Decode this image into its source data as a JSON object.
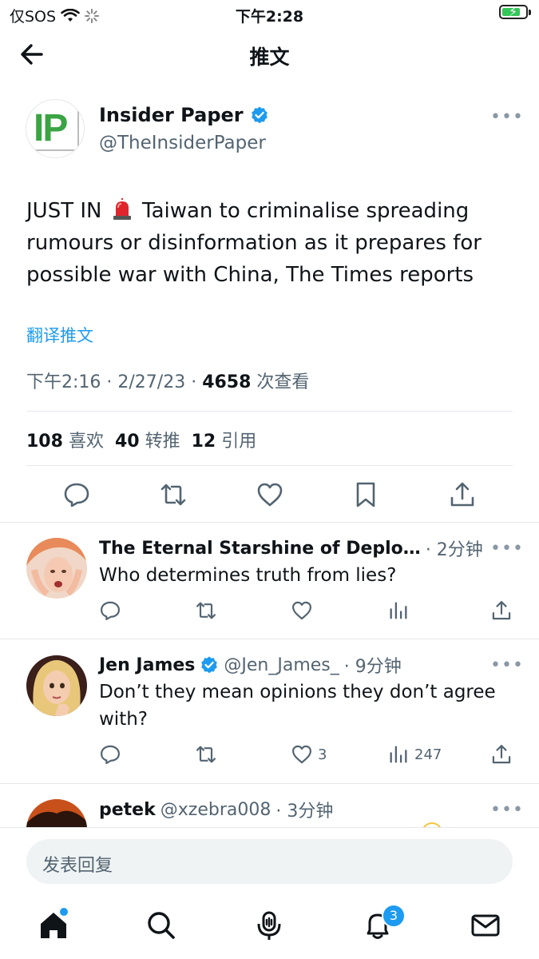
{
  "status_bar": {
    "carrier": "仅SOS",
    "time": "下午2:28"
  },
  "header": {
    "title": "推文"
  },
  "main_tweet": {
    "author_name": "Insider Paper",
    "author_handle": "@TheInsiderPaper",
    "avatar_text": "IP",
    "text_prefix": "JUST IN",
    "text_body": " Taiwan to criminalise spreading rumours or disinformation as it prepares for possible war with China, The Times reports",
    "translate_label": "翻译推文",
    "time": "下午2:16",
    "date": "2/27/23",
    "views_count": "4658",
    "views_label": "次查看",
    "likes_count": "108",
    "likes_label": "喜欢",
    "retweets_count": "40",
    "retweets_label": "转推",
    "quotes_count": "12",
    "quotes_label": "引用"
  },
  "replies": [
    {
      "name": "The Eternal Starshine of Deplo…",
      "time": "· 2分钟",
      "text": "Who determines truth from lies?",
      "likes": "",
      "views": ""
    },
    {
      "name": "Jen James",
      "handle": "@Jen_James_",
      "time": "· 9分钟",
      "text": "Don’t they mean opinions they don’t agree with?",
      "likes": "3",
      "views": "247"
    },
    {
      "name": "petek",
      "handle": "@xzebra008",
      "time": "· 3分钟"
    }
  ],
  "reply_input": {
    "placeholder": "发表回复"
  },
  "nav": {
    "notifications_badge": "3"
  },
  "colors": {
    "accent": "#1d9bf0",
    "text": "#0f1419",
    "secondary": "#536471",
    "logo_green": "#3aa443"
  }
}
